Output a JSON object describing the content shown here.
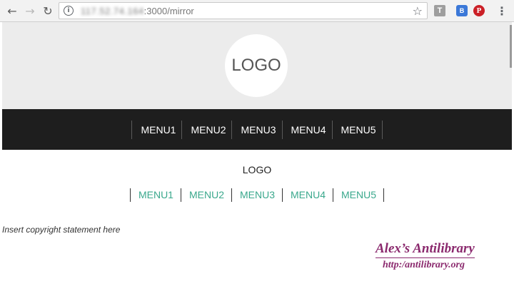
{
  "browser": {
    "back_icon": "←",
    "forward_icon": "→",
    "reload_icon": "↻",
    "info_icon": "i",
    "url_host": "117.52.74.164",
    "url_path": ":3000/mirror",
    "star_icon": "☆",
    "extensions": [
      {
        "name": "t-extension-icon",
        "glyph": "T"
      },
      {
        "name": "b-extension-icon",
        "glyph": "B"
      },
      {
        "name": "pinterest-icon",
        "glyph": "P"
      }
    ],
    "menu_icon": "⋮"
  },
  "header": {
    "logo_text": "LOGO"
  },
  "main_nav": {
    "items": [
      "MENU1",
      "MENU2",
      "MENU3",
      "MENU4",
      "MENU5"
    ]
  },
  "footer": {
    "logo_text": "LOGO",
    "nav_items": [
      "MENU1",
      "MENU2",
      "MENU3",
      "MENU4",
      "MENU5"
    ],
    "copyright": "Insert copyright statement here"
  },
  "watermark": {
    "title": "Alex’s Antilibrary",
    "url": "http:/antilibrary.org"
  },
  "colors": {
    "hero_bg": "#ececec",
    "nav_bg": "#1e1e1e",
    "footer_link": "#3aa88c",
    "watermark": "#8b2a6e"
  }
}
